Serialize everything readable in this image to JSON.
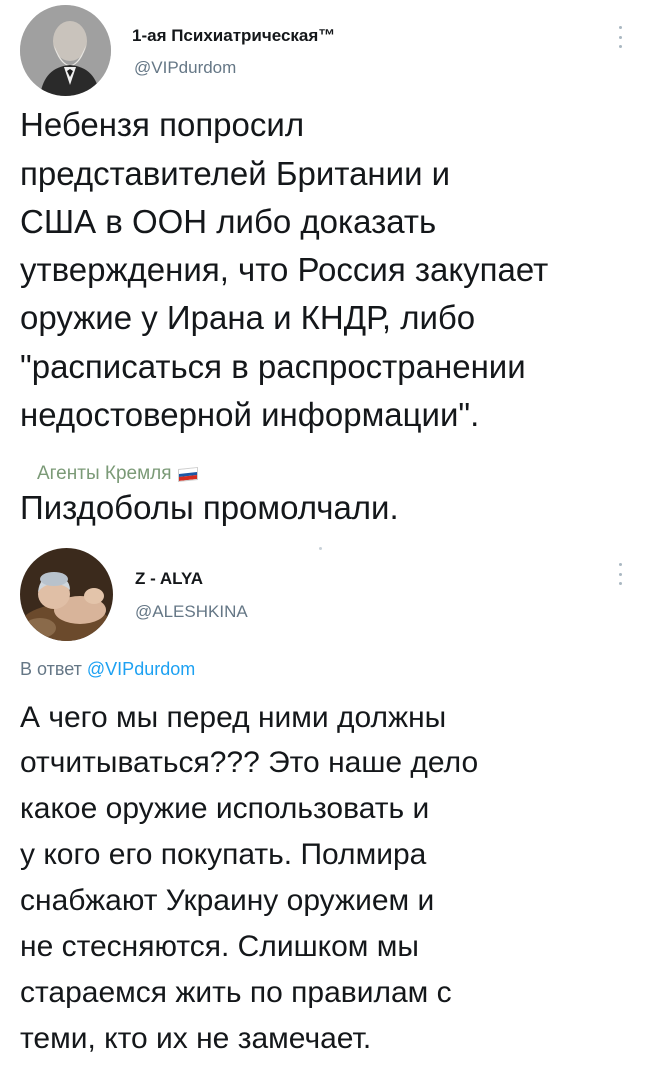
{
  "tweet": {
    "author": {
      "display_name": "1-ая Психиатрическая™",
      "handle": "@VIPdurdom",
      "avatar": "portrait-avatar"
    },
    "text_lines": [
      "Небензя попросил",
      "представителей Британии и",
      "США в ООН либо доказать",
      "утверждения, что Россия закупает",
      "оружие у Ирана и КНДР, либо",
      "\"расписаться в распространении",
      "недостоверной информации\"."
    ],
    "community_label": "Агенты Кремля",
    "community_flag": "russia-flag-icon",
    "followup_text": "Пиздоболы промолчали."
  },
  "reply": {
    "author": {
      "display_name": "Z - ALYA",
      "handle": "@ALESHKINA",
      "avatar": "baby-photo-avatar"
    },
    "reply_to_prefix": "В ответ",
    "reply_to_handle": "@VIPdurdom",
    "text_lines": [
      "А чего мы перед ними должны",
      "отчитываться???  Это наше дело",
      "какое оружие использовать и",
      "у кого его покупать. Полмира",
      "снабжают Украину оружием и",
      "не стесняются. Слишком мы",
      "стараемся жить по правилам с",
      "теми, кто их не замечает."
    ]
  },
  "colors": {
    "text": "#14171a",
    "muted": "#657786",
    "mention": "#1da1f2",
    "community": "#7b9a77"
  }
}
